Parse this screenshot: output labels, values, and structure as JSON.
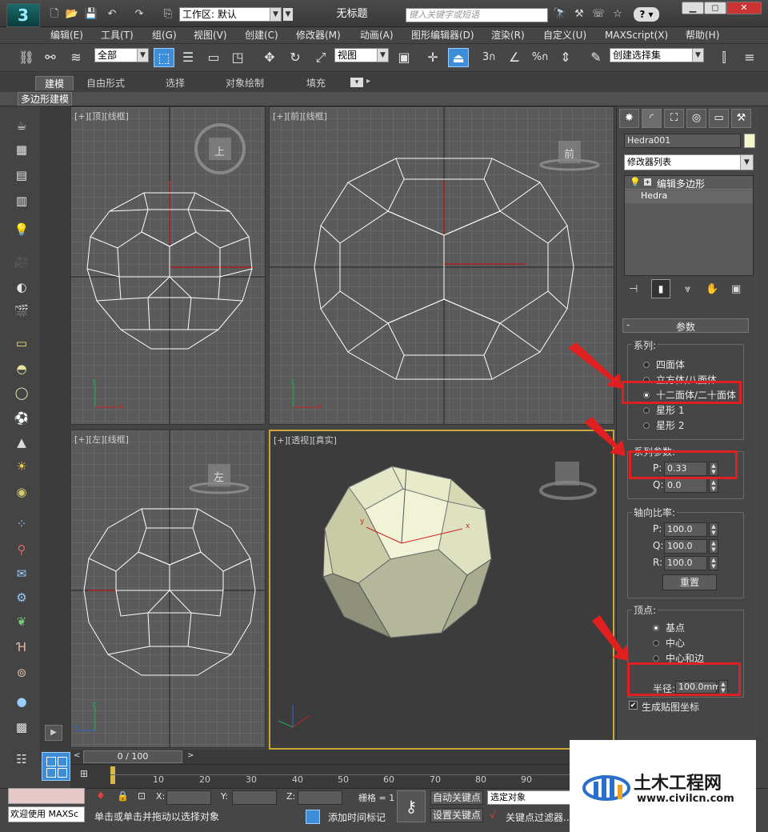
{
  "app": {
    "logo": "3",
    "workspace_label": "工作区: 默认",
    "title": "无标题",
    "search_placeholder": "键入关键字或短语",
    "help_btn": "?"
  },
  "window_controls": [
    "▁",
    "◻",
    "✕"
  ],
  "menu": [
    "编辑(E)",
    "工具(T)",
    "组(G)",
    "视图(V)",
    "创建(C)",
    "修改器(M)",
    "动画(A)",
    "图形编辑器(D)",
    "渲染(R)",
    "自定义(U)",
    "MAXScript(X)",
    "帮助(H)"
  ],
  "toolbar": {
    "selection_filter": "全部",
    "ref_coord": "视图",
    "named_selection": "创建选择集",
    "snap_labels": [
      "3",
      "%"
    ]
  },
  "ribbon": {
    "tabs": [
      "建模",
      "自由形式",
      "选择",
      "对象绘制",
      "填充"
    ],
    "active_tab": "建模",
    "sub_label": "多边形建模"
  },
  "viewports": [
    {
      "label": "[+][顶][线框]",
      "cube": "上"
    },
    {
      "label": "[+][前][线框]",
      "cube": "前"
    },
    {
      "label": "[+][左][线框]",
      "cube": "左"
    },
    {
      "label": "[+][透视][真实]",
      "cube": ""
    }
  ],
  "axis": {
    "x": "x",
    "y": "y",
    "z": "z"
  },
  "command_panel": {
    "object_name": "Hedra001",
    "modifier_list": "修改器列表",
    "stack": [
      "编辑多边形",
      "Hedra"
    ],
    "rollout_title": "参数",
    "rollout_sign": "-",
    "family": {
      "title": "系列:",
      "options": [
        "四面体",
        "立方体/八面体",
        "十二面体/二十面体",
        "星形 1",
        "星形 2"
      ],
      "selected": 2
    },
    "family_params": {
      "title": "系列参数:",
      "p_label": "P:",
      "p_value": "0.33",
      "q_label": "Q:",
      "q_value": "0.0"
    },
    "axis_scale": {
      "title": "轴向比率:",
      "p_label": "P:",
      "p_value": "100.0",
      "q_label": "Q:",
      "q_value": "100.0",
      "r_label": "R:",
      "r_value": "100.0",
      "reset_btn": "重置"
    },
    "vertices": {
      "title": "顶点:",
      "options": [
        "基点",
        "中心",
        "中心和边"
      ],
      "selected": 0
    },
    "radius_label": "半径:",
    "radius_value": "100.0mm",
    "gen_uv_label": "生成贴图坐标",
    "gen_uv_checked": true
  },
  "timeline": {
    "frame": "0 / 100",
    "ticks": [
      "10",
      "20",
      "30",
      "40",
      "50",
      "60",
      "70",
      "80",
      "90"
    ]
  },
  "status": {
    "welcome": "欢迎使用 MAXSc",
    "prompt": "单击或单击并拖动以选择对象",
    "x_label": "X:",
    "y_label": "Y:",
    "z_label": "Z:",
    "grid_label": "栅格 = 1",
    "auto_key": "自动关键点",
    "set_key": "设置关键点",
    "selected_obj": "选定对象",
    "add_time_tag": "添加时间标记",
    "key_filters": "关键点过滤器..."
  },
  "watermark": {
    "brand": "土木工程网",
    "url": "www.civilcn.com"
  },
  "colors": {
    "accent_blue": "#3d8ed6",
    "highlight_red": "#e02020",
    "viewport_gold": "#c8a63a",
    "model_face": "#e9ecc8"
  }
}
